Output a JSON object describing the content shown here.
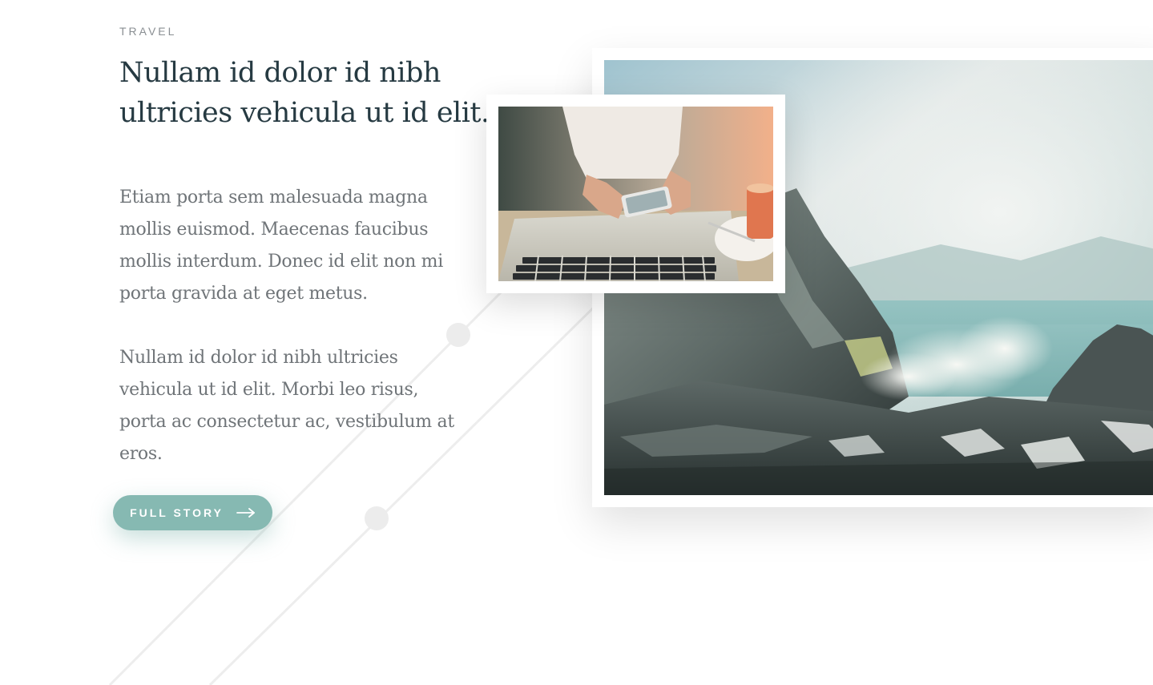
{
  "article": {
    "category": "TRAVEL",
    "title": "Nullam id dolor id nibh ultricies vehicula ut id elit.",
    "paragraphs": [
      "Etiam porta sem malesuada magna mollis euismod. Maecenas faucibus mollis interdum. Donec id elit non mi porta gravida at eget metus.",
      "Nullam id dolor id nibh ultricies vehicula ut id elit. Morbi leo risus, porta ac consectetur ac, vestibulum at eros."
    ],
    "cta": {
      "label": "FULL STORY",
      "icon": "arrow-right-icon"
    }
  },
  "colors": {
    "accent": "#86b9b2",
    "heading": "#263a42",
    "body": "#6f7478",
    "category": "#8a8f93",
    "decoration": "#ececec"
  },
  "images": {
    "primary": "volcanic-crater-steam-photo",
    "secondary": "hands-phone-laptop-coffee-photo"
  }
}
